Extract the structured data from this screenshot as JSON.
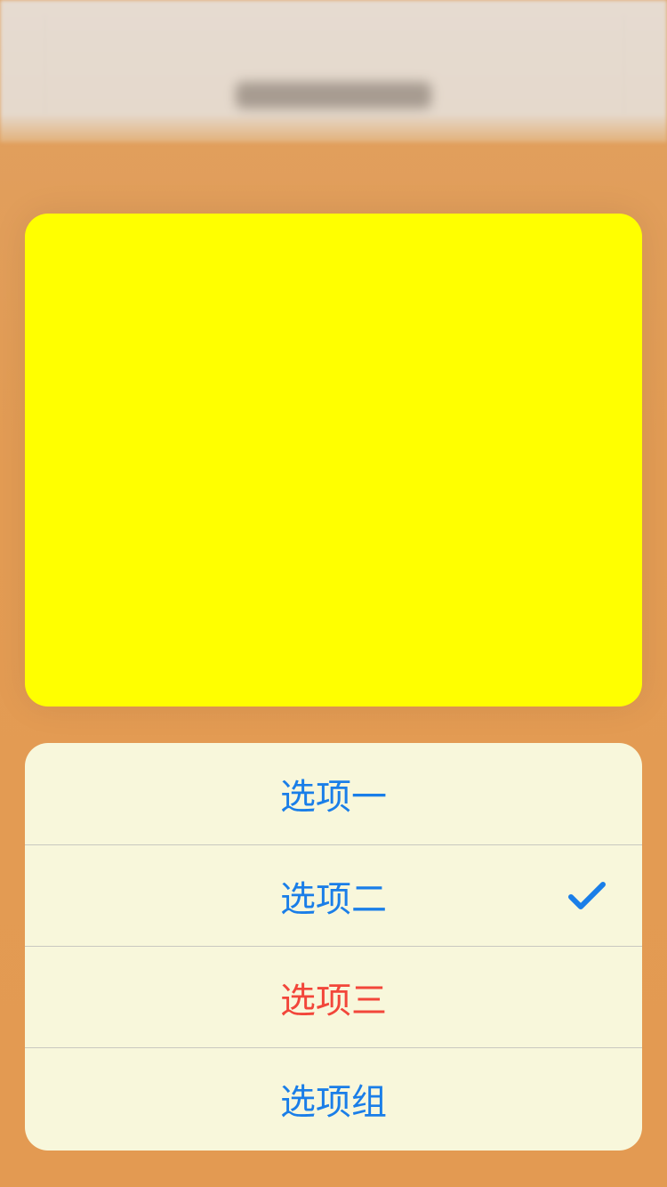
{
  "menu": {
    "items": [
      {
        "label": "选项一",
        "selected": false,
        "style": "default"
      },
      {
        "label": "选项二",
        "selected": true,
        "style": "default"
      },
      {
        "label": "选项三",
        "selected": false,
        "style": "destructive"
      },
      {
        "label": "选项组",
        "selected": false,
        "style": "default"
      }
    ]
  },
  "icons": {
    "selected_indicator": "checkmark-icon"
  },
  "colors": {
    "accent": "#1a7ee8",
    "destructive": "#f2463a",
    "menu_background": "#f8f7db",
    "preview_background": "#ffff00",
    "backdrop": "#e39c54"
  }
}
